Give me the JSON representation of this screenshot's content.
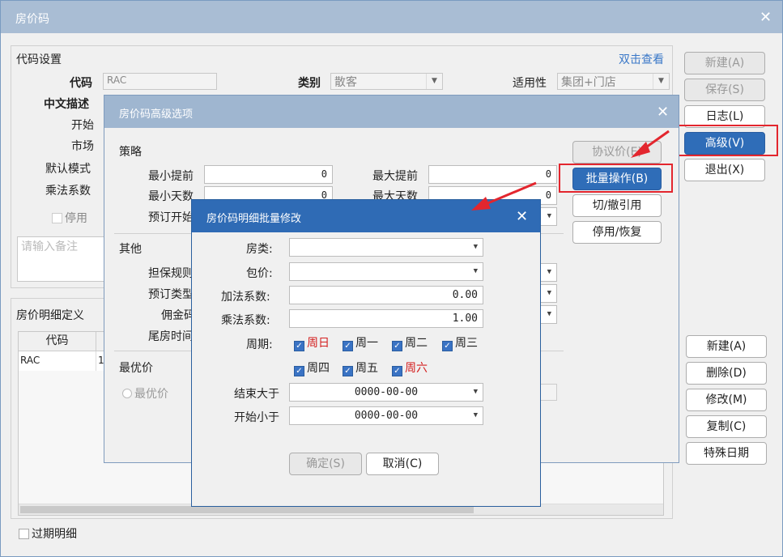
{
  "main": {
    "title": "房价码",
    "code_settings": "代码设置",
    "dbl_click_view": "双击查看",
    "code_label": "代码",
    "code_value": "RAC",
    "category_label": "类别",
    "category_value": "散客",
    "applicability_label": "适用性",
    "applicability_value": "集团+门店",
    "cn_desc_label": "中文描述",
    "start_label": "开始",
    "market_label": "市场",
    "default_mode_label": "默认模式",
    "mult_factor_label": "乘法系数",
    "disable_label": "停用",
    "remark_placeholder": "请输入备注",
    "detail_def": "房价明细定义",
    "table_header_code": "代码",
    "table_row_code": "RAC",
    "table_row_col2": "1",
    "expired_detail": "过期明细",
    "buttons_top": [
      "新建(A)",
      "保存(S)",
      "日志(L)",
      "高级(V)",
      "退出(X)"
    ],
    "buttons_bottom": [
      "新建(A)",
      "删除(D)",
      "修改(M)",
      "复制(C)",
      "特殊日期"
    ]
  },
  "adv": {
    "title": "房价码高级选项",
    "strategy": "策略",
    "min_advance": "最小提前",
    "min_advance_val": "0",
    "max_advance": "最大提前",
    "max_advance_val": "0",
    "min_days": "最小天数",
    "min_days_val": "0",
    "max_days": "最大天数",
    "max_days_val": "0",
    "booking_start": "预订开始",
    "other": "其他",
    "guarantee": "担保规则",
    "booking_type": "预订类型",
    "commission": "佣金码",
    "tail_time": "尾房时间",
    "best_price": "最优价",
    "best_price_radio": "最优价",
    "buttons": [
      "协议价(E)",
      "批量操作(B)",
      "切/撤引用",
      "停用/恢复"
    ]
  },
  "batch": {
    "title": "房价码明细批量修改",
    "room_type": "房类:",
    "package": "包价:",
    "add_factor": "加法系数:",
    "add_factor_val": "0.00",
    "mult_factor": "乘法系数:",
    "mult_factor_val": "1.00",
    "cycle": "周期:",
    "days": [
      {
        "label": "周日",
        "weekend": true
      },
      {
        "label": "周一",
        "weekend": false
      },
      {
        "label": "周二",
        "weekend": false
      },
      {
        "label": "周三",
        "weekend": false
      },
      {
        "label": "周四",
        "weekend": false
      },
      {
        "label": "周五",
        "weekend": false
      },
      {
        "label": "周六",
        "weekend": true
      }
    ],
    "end_after": "结束大于",
    "end_after_val": "0000-00-00",
    "start_before": "开始小于",
    "start_before_val": "0000-00-00",
    "ok": "确定(S)",
    "cancel": "取消(C)"
  },
  "colors": {
    "accent": "#2f6db8",
    "highlight": "#e3262e",
    "weekend": "#d42020"
  }
}
